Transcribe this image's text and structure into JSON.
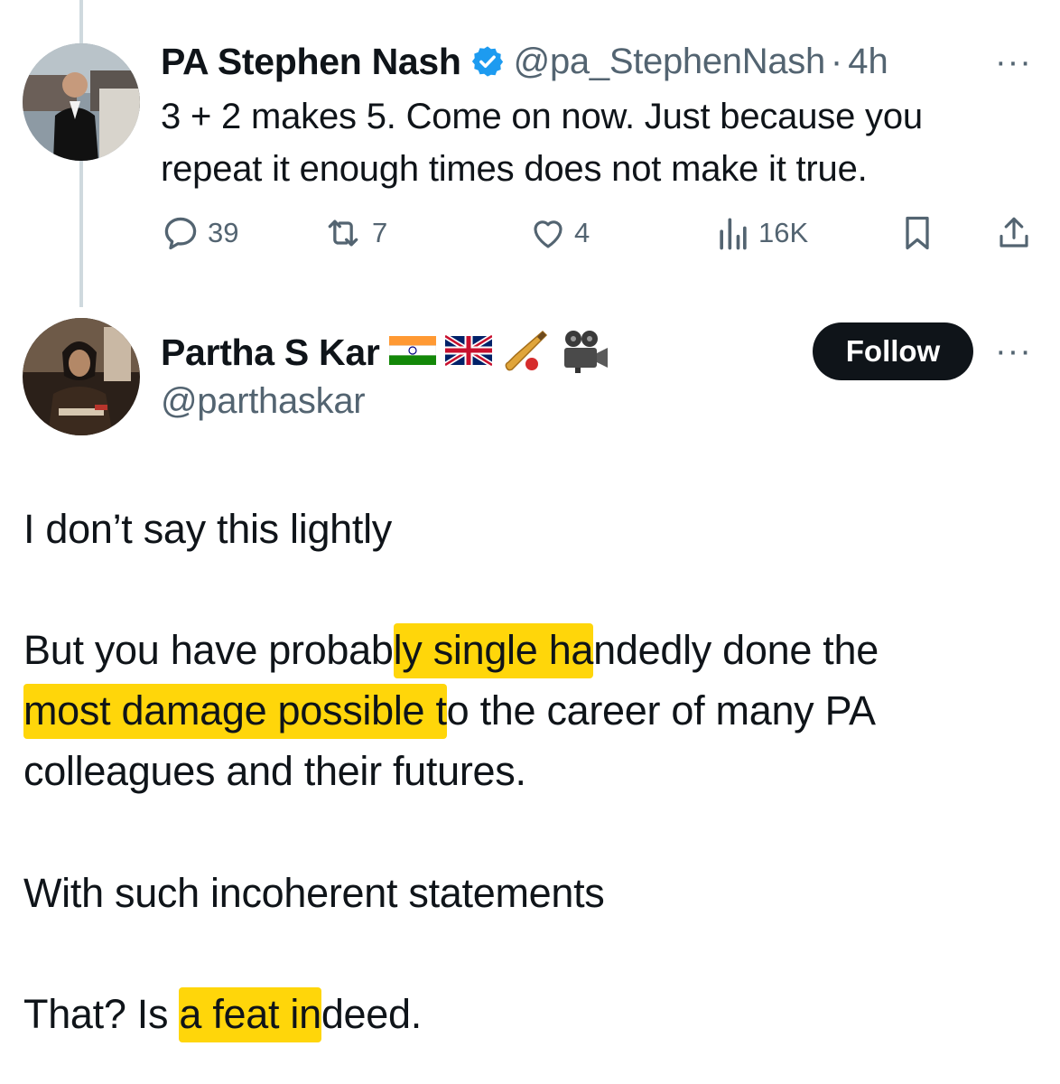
{
  "tweet1": {
    "name": "PA Stephen Nash",
    "handle": "@pa_StephenNash",
    "separator": "·",
    "time": "4h",
    "more": "···",
    "text": "3 + 2 makes 5. Come on now. Just because you repeat it enough times does not make it true.",
    "actions": {
      "replies": "39",
      "retweets": "7",
      "likes": "4",
      "views": "16K"
    },
    "colors": {
      "verified": "#1d9bf0",
      "secondary_text": "#536471",
      "thread_line": "#cfd9de"
    }
  },
  "tweet2": {
    "name": "Partha S Kar",
    "name_emojis": [
      "🇮🇳",
      "🇬🇧",
      "🏏",
      "🎥"
    ],
    "handle": "@parthaskar",
    "follow_label": "Follow",
    "more": "···",
    "paragraphs": {
      "p1": "I don’t say this lightly",
      "p2": {
        "a": "But you have probab",
        "b": "ly single ha",
        "c": "ndedly done the",
        "d": "most damage possible t",
        "e": "o the career of many PA",
        "f": "colleagues and their futures."
      },
      "p3": "With such incoherent statements",
      "p4": {
        "a": "That? Is ",
        "b": "a feat in",
        "c": "deed."
      }
    },
    "colors": {
      "highlight": "#ffd60a",
      "follow_button": "#0f1419"
    }
  }
}
